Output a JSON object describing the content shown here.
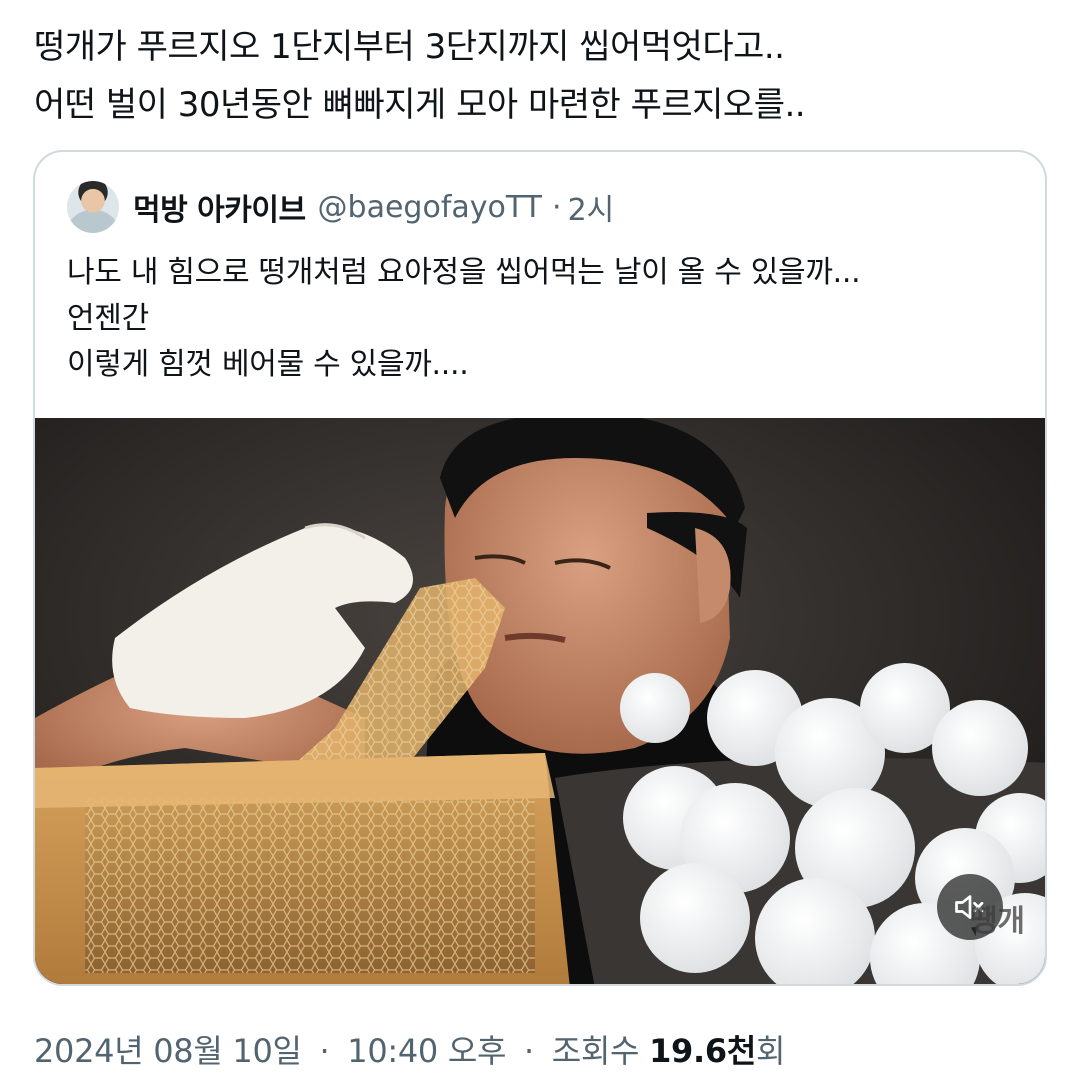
{
  "tweet": {
    "text_lines": [
      "떵개가 푸르지오 1단지부터 3단지까지 씹어먹엇다고..",
      "어떤 벌이 30년동안 뼈빠지게 모아 마련한 푸르지오를.."
    ]
  },
  "quote": {
    "author_name": "먹방 아카이브",
    "author_handle": "@baegofayoTT",
    "separator": "·",
    "time": "2시",
    "body_lines": [
      "나도 내 힘으로 떵개처럼 요아정을 씹어먹는 날이 올 수 있을까...",
      "언젠간",
      "이렇게 힘껏 베어물 수 있을까...."
    ],
    "media": {
      "icon": "mute-icon",
      "watermark": "땡개"
    }
  },
  "footer": {
    "date": "2024년 08월 10일",
    "separator": "·",
    "time": "10:40 오후",
    "views_label": "조회수",
    "views_count": "19.6천",
    "views_suffix": "회"
  },
  "colors": {
    "text_primary": "#0f1419",
    "text_secondary": "#536471",
    "card_border": "#cfd9de"
  }
}
